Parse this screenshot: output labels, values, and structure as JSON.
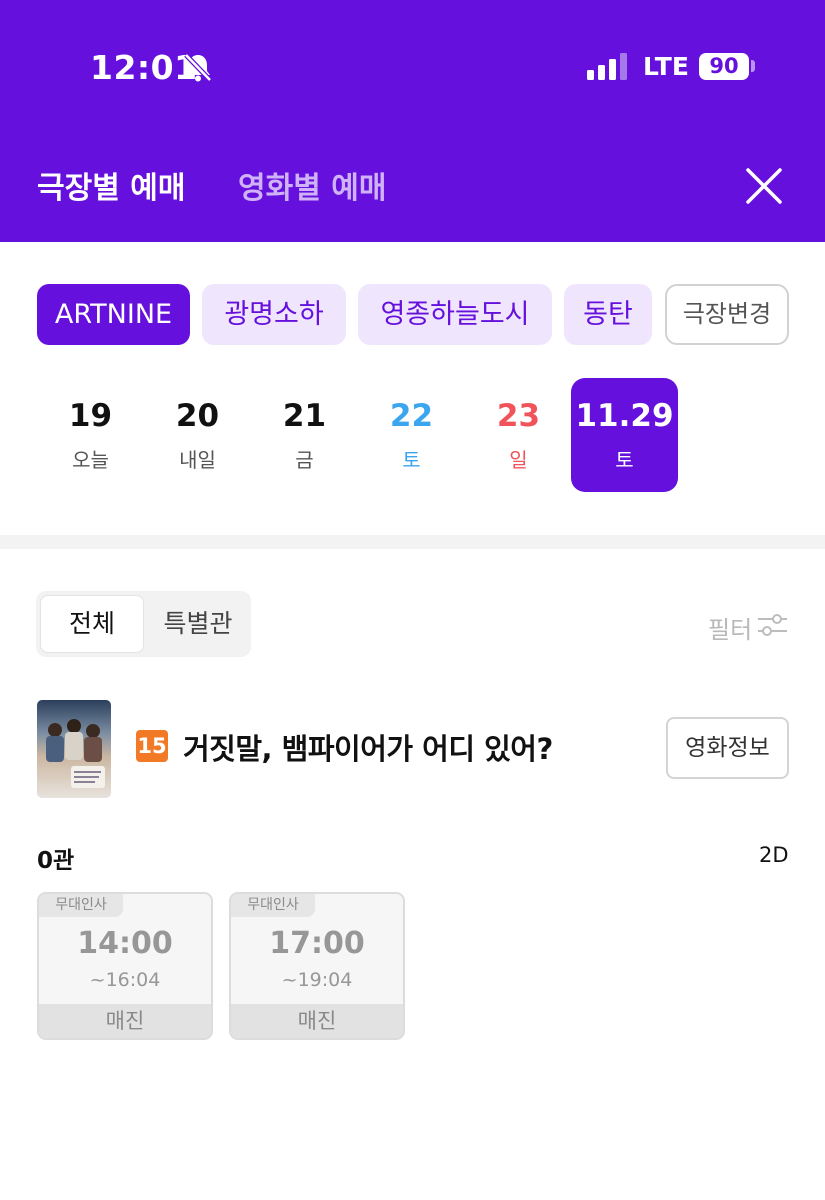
{
  "status_bar": {
    "time": "12:01",
    "network": "LTE",
    "battery": "90",
    "icons": [
      "bell-muted-icon",
      "signal-icon"
    ]
  },
  "header": {
    "tabs": [
      {
        "label": "극장별 예매",
        "active": true
      },
      {
        "label": "영화별 예매",
        "active": false
      }
    ],
    "close_icon": "close-icon",
    "background": "#6510dc"
  },
  "theaters": {
    "chips": [
      "ARTNINE",
      "광명소하",
      "영종하늘도시",
      "동탄"
    ],
    "selected": "ARTNINE",
    "change_label": "극장변경"
  },
  "dates": [
    {
      "num": "19",
      "day": "오늘"
    },
    {
      "num": "20",
      "day": "내일"
    },
    {
      "num": "21",
      "day": "금"
    },
    {
      "num": "22",
      "day": "토"
    },
    {
      "num": "23",
      "day": "일"
    },
    {
      "num": "11.29",
      "day": "토"
    }
  ],
  "date_colors": {
    "saturday": "#3ba6ef",
    "sunday": "#f0545a",
    "default": "#111111"
  },
  "segment": {
    "all": "전체",
    "special": "특별관",
    "selected": "전체"
  },
  "filter": {
    "label": "필터",
    "icon": "filter-sliders-icon"
  },
  "movie": {
    "age_rating": "15",
    "title": "거짓말, 뱀파이어가 어디 있어?",
    "info_button": "영화정보",
    "poster_icon": "movie-poster"
  },
  "hall": {
    "name": "0관",
    "format": "2D",
    "showtimes": [
      {
        "tag": "무대인사",
        "start": "14:00",
        "end": "~16:04",
        "status": "매진"
      },
      {
        "tag": "무대인사",
        "start": "17:00",
        "end": "~19:04",
        "status": "매진"
      }
    ]
  }
}
